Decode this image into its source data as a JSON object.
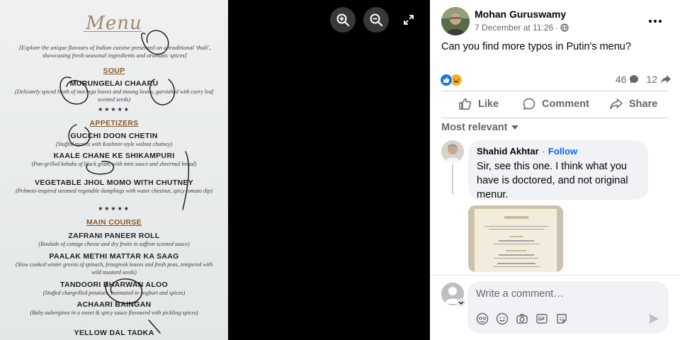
{
  "viewer": {
    "menu": {
      "title": "Menu",
      "intro": "[Explore the unique flavours of Indian cuisine presented on a traditional 'thali', showcasing fresh seasonal ingredients and aromatic spices]",
      "sections": [
        {
          "name": "SOUP"
        },
        {
          "name": "APPETIZERS"
        },
        {
          "name": "MAIN COURSE"
        }
      ],
      "dishes": [
        {
          "name": "MURUNGELAI CHAARU",
          "desc": "(Delicately spiced broth of moringa leaves and moong beans, garnished with curry leaf scented seeds)"
        },
        {
          "name": "GUCCHI DOON CHETIN",
          "desc": "(Stuffed morels with Kashmir-style walnut chutney)"
        },
        {
          "name": "KAALE CHANE KE SHIKAMPURI",
          "desc": "(Pan-grilled kebabs of black gram, with mint sauce and sheermal bread)"
        },
        {
          "name": "VEGETABLE JHOL MOMO WITH CHUTNEY",
          "desc": "(Pelmeni-inspired steamed vegetable dumplings with water chestnut, spicy tomato dip)"
        },
        {
          "name": "ZAFRANI PANEER ROLL",
          "desc": "(Roulade of cottage cheese and dry fruits in saffron scented sauce)"
        },
        {
          "name": "PAALAK METHI MATTAR KA SAAG",
          "desc": "(Slow cooked winter greens of spinach, fenugreek leaves and fresh peas, tempered with wild mustard seeds)"
        },
        {
          "name": "TANDOORI BHARWAN ALOO",
          "desc": "(Stuffed chargrilled potatoes, mannated in yoghurt and spices)"
        },
        {
          "name": "ACHAARI BAINGAN",
          "desc": "(Baby aubergines in a sweet & spicy sauce flavoured with pickling spices)"
        },
        {
          "name": "YELLOW DAL TADKA",
          "desc": ""
        }
      ],
      "stars": "★★★★★"
    },
    "controls": {
      "zoom_in_icon": "zoom-in-icon",
      "zoom_out_icon": "zoom-out-icon",
      "fullscreen_icon": "expand-icon"
    }
  },
  "post": {
    "author": "Mohan Guruswamy",
    "date": "7 December at 11:26",
    "separator": "·",
    "audience_icon": "globe-icon",
    "text": "Can you find more typos in Putin's menu?",
    "reactions": [
      "like",
      "haha"
    ],
    "comments_count": "46",
    "shares_count": "12",
    "actions": {
      "like": "Like",
      "comment": "Comment",
      "share": "Share"
    },
    "sort_label": "Most relevant",
    "comment": {
      "author": "Shahid Akhtar",
      "follow": "Follow",
      "dot": "·",
      "text": "Sir, see this one. I think what you have is doctored, and not original menur."
    },
    "compose": {
      "placeholder": "Write a comment…"
    }
  },
  "colors": {
    "accent": "#0866ff",
    "like_blue": "#1b74e4",
    "haha_yellow": "#f7b125",
    "muted_text": "#65676b",
    "menu_gold": "#a08a6a"
  }
}
